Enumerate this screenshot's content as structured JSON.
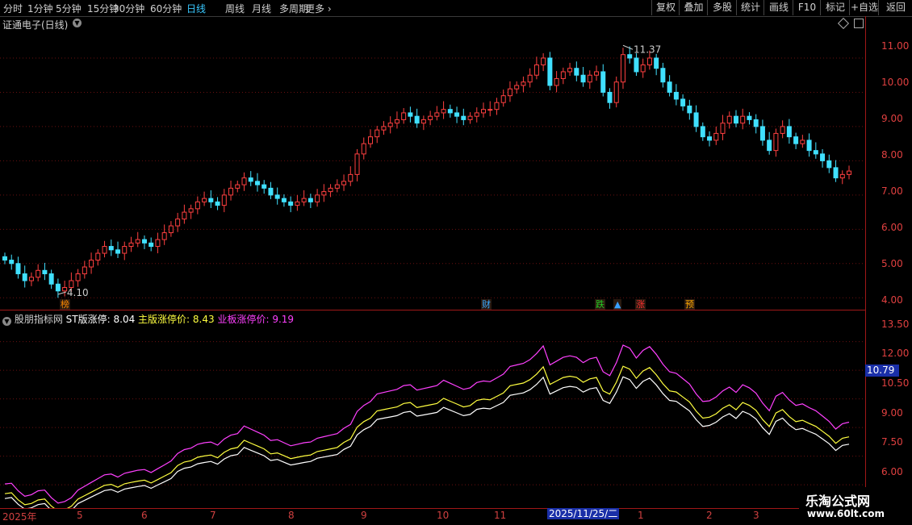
{
  "toolbar": {
    "periods": [
      "分时",
      "1分钟",
      "5分钟",
      "15分钟",
      "30分钟",
      "60分钟",
      "日线",
      "周线",
      "月线",
      "多周期",
      "更多"
    ],
    "active": "日线",
    "right_buttons": [
      "复权",
      "叠加",
      "多股",
      "统计",
      "画线",
      "F10",
      "标记",
      "+自选",
      "返回"
    ]
  },
  "stock": {
    "title": "证通电子(日线)",
    "high_label": "11.37",
    "low_label": "4.10"
  },
  "price_axis": {
    "labels": [
      "11.00",
      "10.00",
      "9.00",
      "8.00",
      "7.00",
      "6.00",
      "5.00",
      "4.00"
    ]
  },
  "indicator": {
    "name": "股朋指标网",
    "st_label": "ST版涨停:",
    "st_value": "8.04",
    "main_label": "主版涨停价:",
    "main_value": "8.43",
    "pro_label": "业板涨停价:",
    "pro_value": "9.19",
    "axis_labels": [
      "13.50",
      "12.00",
      "10.50",
      "9.00",
      "7.50",
      "6.00"
    ],
    "current_value": "10.79"
  },
  "badges": [
    {
      "text": "榜",
      "color": "#ff8a00"
    },
    {
      "text": "财",
      "color": "#38a8ff"
    },
    {
      "text": "跌",
      "color": "#22cc22"
    },
    {
      "text": "▲",
      "color": "#3aa0ff"
    },
    {
      "text": "涨",
      "color": "#ff3030"
    },
    {
      "text": "预",
      "color": "#ffaa00"
    }
  ],
  "dates": [
    "2025年",
    "5",
    "6",
    "7",
    "8",
    "9",
    "10",
    "11",
    "1",
    "2",
    "3"
  ],
  "current_date": "2025/11/25/二",
  "watermark": {
    "line1": "乐淘公式网",
    "line2": "www.60lt.com"
  },
  "colors": {
    "up": "#ff4040",
    "down": "#40e0ff",
    "st_line": "#ffffff",
    "main_line": "#ffff40",
    "pro_line": "#ff40ff",
    "accent": "#a01818"
  },
  "chart_data": {
    "type": "candlestick",
    "close": [
      5.1,
      5.0,
      4.7,
      4.5,
      4.6,
      4.8,
      4.7,
      4.4,
      4.2,
      4.3,
      4.5,
      4.7,
      4.9,
      5.1,
      5.3,
      5.5,
      5.4,
      5.3,
      5.5,
      5.6,
      5.7,
      5.6,
      5.5,
      5.7,
      5.9,
      6.1,
      6.3,
      6.5,
      6.6,
      6.8,
      6.9,
      6.8,
      6.7,
      7.0,
      7.2,
      7.3,
      7.5,
      7.4,
      7.3,
      7.2,
      7.0,
      6.9,
      6.8,
      6.7,
      6.8,
      6.9,
      6.8,
      7.0,
      7.1,
      7.2,
      7.3,
      7.4,
      7.6,
      8.2,
      8.5,
      8.7,
      8.9,
      9.0,
      9.1,
      9.2,
      9.4,
      9.3,
      9.1,
      9.2,
      9.3,
      9.4,
      9.5,
      9.4,
      9.3,
      9.2,
      9.3,
      9.4,
      9.5,
      9.5,
      9.7,
      9.9,
      10.1,
      10.2,
      10.3,
      10.5,
      10.8,
      11.0,
      10.2,
      10.4,
      10.6,
      10.7,
      10.5,
      10.3,
      10.5,
      10.6,
      10.0,
      9.7,
      10.3,
      11.1,
      11.0,
      10.6,
      10.8,
      11.0,
      10.7,
      10.3,
      10.0,
      9.8,
      9.6,
      9.4,
      9.0,
      8.7,
      8.6,
      8.8,
      9.1,
      9.3,
      9.1,
      9.3,
      9.2,
      9.0,
      8.6,
      8.3,
      8.8,
      9.0,
      8.7,
      8.5,
      8.6,
      8.3,
      8.2,
      8.0,
      7.8,
      7.5,
      7.6,
      7.7
    ],
    "price_range": [
      3.7,
      11.8
    ],
    "high": 11.37,
    "low": 4.1,
    "indicator_range": [
      5.2,
      14.5
    ],
    "indicator_series": [
      {
        "name": "ST版涨停",
        "color": "#ffffff"
      },
      {
        "name": "主版涨停价",
        "color": "#ffff40"
      },
      {
        "name": "业板涨停价",
        "color": "#ff40ff"
      }
    ]
  }
}
